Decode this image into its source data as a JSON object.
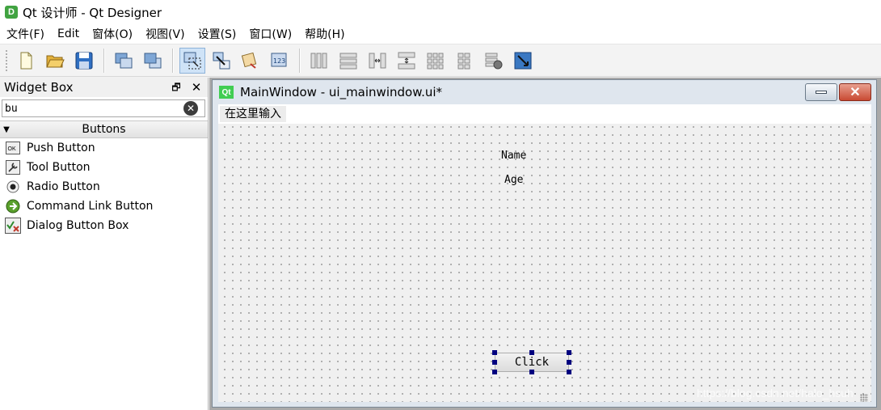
{
  "window": {
    "title": "Qt 设计师 - Qt Designer",
    "app_icon_letter": "D"
  },
  "menubar": {
    "items": [
      "文件(F)",
      "Edit",
      "窗体(O)",
      "视图(V)",
      "设置(S)",
      "窗口(W)",
      "帮助(H)"
    ]
  },
  "toolbar": {
    "buttons": [
      "new-form-icon",
      "open-form-icon",
      "save-form-icon",
      "send-back-icon",
      "bring-front-icon",
      "edit-widgets-icon",
      "edit-signals-slots-icon",
      "edit-buddies-icon",
      "edit-tab-order-icon",
      "layout-horizontal-icon",
      "layout-vertical-icon",
      "layout-horizontal-splitter-icon",
      "layout-vertical-splitter-icon",
      "layout-grid-icon",
      "layout-form-icon",
      "break-layout-icon",
      "adjust-size-icon"
    ],
    "active": "edit-widgets-icon"
  },
  "widget_box": {
    "title": "Widget Box",
    "search_value": "bu",
    "category": "Buttons",
    "items": [
      "Push Button",
      "Tool Button",
      "Radio Button",
      "Command Link Button",
      "Dialog Button Box"
    ]
  },
  "subwindow": {
    "badge": "Qt",
    "title": "MainWindow - ui_mainwindow.ui*"
  },
  "form": {
    "menu_placeholder": "在这里输入",
    "label_name": "Name",
    "label_age": "Age",
    "button_label": "Click"
  },
  "watermark": "https://blog.csdn.net/halo_hsuh"
}
